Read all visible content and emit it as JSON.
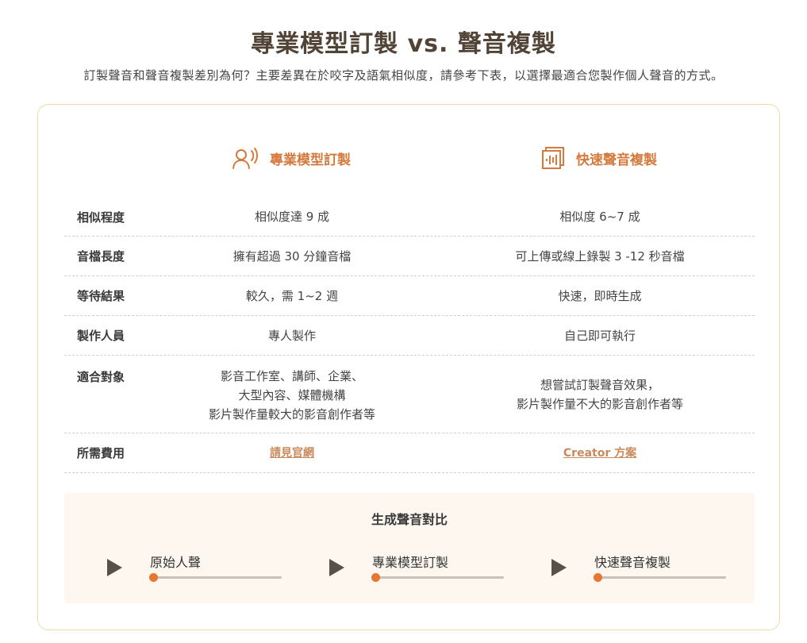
{
  "header": {
    "title": "專業模型訂製 vs. 聲音複製",
    "subtitle": "訂製聲音和聲音複製差別為何？主要差異在於咬字及語氣相似度，請參考下表，以選擇最適合您製作個人聲音的方式。"
  },
  "columns": [
    {
      "label": "專業模型訂製",
      "icon": "speaking-person-icon"
    },
    {
      "label": "快速聲音複製",
      "icon": "audio-waveform-icon"
    }
  ],
  "rows": [
    {
      "label": "相似程度",
      "a": "相似度達 9 成",
      "b": "相似度 6~7 成"
    },
    {
      "label": "音檔長度",
      "a": "擁有超過 30 分鐘音檔",
      "b": "可上傳或線上錄製 3 -12 秒音檔"
    },
    {
      "label": "等待結果",
      "a": "較久，需 1~2 週",
      "b": "快速，即時生成"
    },
    {
      "label": "製作人員",
      "a": "專人製作",
      "b": "自己即可執行"
    },
    {
      "label": "適合對象",
      "a_lines": [
        "影音工作室、講師、企業、",
        "大型內容、媒體機構",
        "影片製作量較大的影音創作者等"
      ],
      "b_lines": [
        "想嘗試訂製聲音效果，",
        "影片製作量不大的影音創作者等"
      ]
    },
    {
      "label": "所需費用",
      "a": "請見官網",
      "b": "Creator 方案"
    }
  ],
  "compare": {
    "title": "生成聲音對比",
    "players": [
      {
        "label": "原始人聲",
        "progress": 0
      },
      {
        "label": "專業模型訂製",
        "progress": 0
      },
      {
        "label": "快速聲音複製",
        "progress": 0
      }
    ]
  },
  "colors": {
    "accent": "#d47a3c",
    "title": "#514437",
    "card_border": "#f1d9a7",
    "compare_bg": "#fdf7f0",
    "knob": "#e67632",
    "play": "#5a5048"
  }
}
